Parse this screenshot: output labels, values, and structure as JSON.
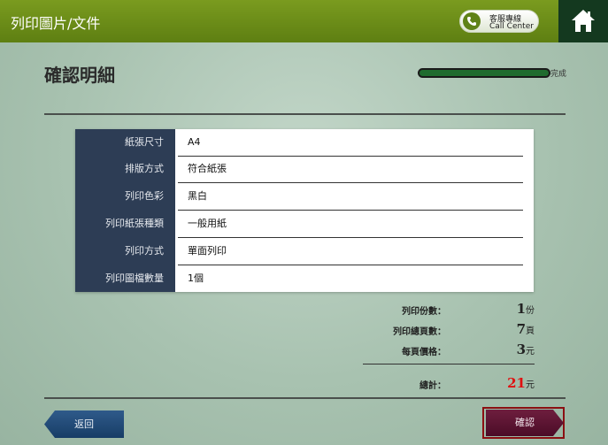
{
  "header": {
    "title": "列印圖片/文件",
    "call_line1": "客服專線",
    "call_line2": "Call Center"
  },
  "page": {
    "title": "確認明細",
    "progress_label": "完成"
  },
  "details": [
    {
      "label": "紙張尺寸",
      "value": "A4"
    },
    {
      "label": "排版方式",
      "value": "符合紙張"
    },
    {
      "label": "列印色彩",
      "value": "黑白"
    },
    {
      "label": "列印紙張種類",
      "value": "一般用紙"
    },
    {
      "label": "列印方式",
      "value": "單面列印"
    },
    {
      "label": "列印圖檔數量",
      "value": "1個"
    }
  ],
  "summary": {
    "copies_label": "列印份數：",
    "copies_value": "1",
    "copies_unit": "份",
    "pages_label": "列印總頁數：",
    "pages_value": "7",
    "pages_unit": "頁",
    "price_label": "每頁價格：",
    "price_value": "3",
    "price_unit": "元",
    "total_label": "總計：",
    "total_value": "21",
    "total_unit": "元"
  },
  "buttons": {
    "back": "返回",
    "confirm": "確認"
  },
  "icons": {
    "phone": "phone-icon",
    "home": "home-icon"
  },
  "colors": {
    "header": "#6a8c18",
    "total": "#e01010",
    "panel": "#2d3d55"
  }
}
